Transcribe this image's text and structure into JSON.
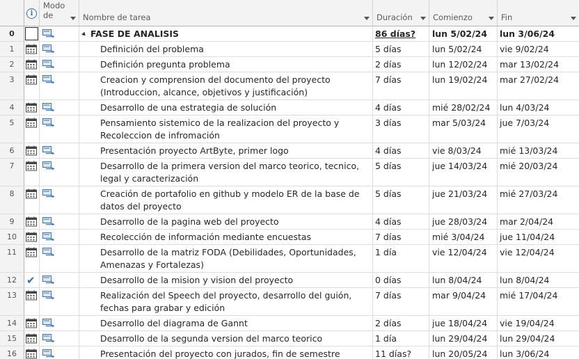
{
  "columns": {
    "modo_line1": "Modo",
    "modo_line2": "de",
    "name": "Nombre de tarea",
    "duration": "Duración",
    "start": "Comienzo",
    "end": "Fin"
  },
  "tasks": [
    {
      "id": "0",
      "indicator": "none",
      "name": "FASE DE ANALISIS",
      "duration": "86 días?",
      "start": "lun 5/02/24",
      "end": "lun 3/06/24",
      "summary": true
    },
    {
      "id": "1",
      "indicator": "calendar",
      "name": "Definición del problema",
      "duration": "5 días",
      "start": "lun 5/02/24",
      "end": "vie 9/02/24"
    },
    {
      "id": "2",
      "indicator": "calendar",
      "name": "Definición pregunta problema",
      "duration": "2 días",
      "start": "lun 12/02/24",
      "end": "mar 13/02/24"
    },
    {
      "id": "3",
      "indicator": "calendar",
      "name": "Creacion y comprension del documento del proyecto (Introduccion, alcance, objetivos y justificación)",
      "duration": "7 días",
      "start": "lun 19/02/24",
      "end": "mar 27/02/24"
    },
    {
      "id": "4",
      "indicator": "calendar",
      "name": "Desarrollo de una estrategia de solución",
      "duration": "4 días",
      "start": "mié 28/02/24",
      "end": "lun 4/03/24"
    },
    {
      "id": "5",
      "indicator": "calendar",
      "name": "Pensamiento sistemico de la realizacion del proyecto y Recoleccion de infromación",
      "duration": "3 días",
      "start": "mar 5/03/24",
      "end": "jue 7/03/24"
    },
    {
      "id": "6",
      "indicator": "calendar",
      "name": "Presentación proyecto ArtByte, primer logo",
      "duration": "4 días",
      "start": "vie 8/03/24",
      "end": "mié 13/03/24"
    },
    {
      "id": "7",
      "indicator": "calendar",
      "name": "Desarrollo de la primera version del marco teorico, tecnico, legal y caracterización",
      "duration": "5 días",
      "start": "jue 14/03/24",
      "end": "mié 20/03/24"
    },
    {
      "id": "8",
      "indicator": "calendar",
      "name": "Creación de portafolio en github y modelo ER de la base de datos del proyecto",
      "duration": "5 días",
      "start": "jue 21/03/24",
      "end": "mié 27/03/24"
    },
    {
      "id": "9",
      "indicator": "calendar",
      "name": "Desarrollo de la pagina web del proyecto",
      "duration": "4 días",
      "start": "jue 28/03/24",
      "end": "mar 2/04/24"
    },
    {
      "id": "10",
      "indicator": "calendar",
      "name": "Recolección de información mediante encuestas",
      "duration": "7 días",
      "start": "mié 3/04/24",
      "end": "jue 11/04/24"
    },
    {
      "id": "11",
      "indicator": "calendar",
      "name": "Desarrollo de la matriz FODA (Debilidades, Oportunidades, Amenazas y  Fortalezas)",
      "duration": "1 día",
      "start": "vie 12/04/24",
      "end": "vie 12/04/24"
    },
    {
      "id": "12",
      "indicator": "check",
      "name": "Desarrollo de la mision y vision del proyecto",
      "duration": "0 días",
      "start": "lun 8/04/24",
      "end": "lun 8/04/24"
    },
    {
      "id": "13",
      "indicator": "calendar",
      "name": "Realización del Speech del proyecto, desarrollo del guión, fechas para grabar y edición",
      "duration": "7 días",
      "start": "mar 9/04/24",
      "end": "mié 17/04/24"
    },
    {
      "id": "14",
      "indicator": "calendar",
      "name": "Desarrollo del diagrama de Gannt",
      "duration": "2 días",
      "start": "jue 18/04/24",
      "end": "vie 19/04/24"
    },
    {
      "id": "15",
      "indicator": "calendar",
      "name": "Desarrollo de la segunda version del marco teorico",
      "duration": "1 día",
      "start": "lun 29/04/24",
      "end": "lun 29/04/24"
    },
    {
      "id": "16",
      "indicator": "calendar",
      "name": "Presentación del proyecto con jurados, fin de semestre",
      "duration": "11 días?",
      "start": "lun 20/05/24",
      "end": "lun 3/06/24"
    }
  ],
  "colors": {
    "accent": "#2f6fb5",
    "header_bg": "#f3f3f3",
    "grid_line": "#dcdcdc"
  },
  "icons": {
    "indicator_header": "info-icon",
    "mode": "auto-schedule-icon",
    "calendar": "calendar-icon",
    "check": "check-icon"
  }
}
